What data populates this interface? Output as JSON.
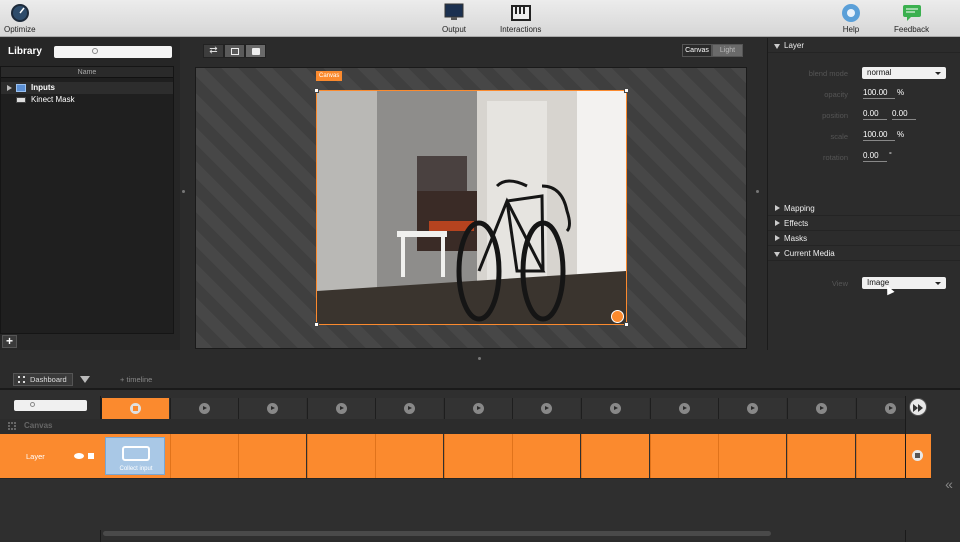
{
  "toolbar": {
    "optimize": "Optimize",
    "output": "Output",
    "interactions": "Interactions",
    "help": "Help",
    "feedback": "Feedback"
  },
  "library": {
    "title": "Library",
    "column_header": "Name",
    "items": [
      {
        "label": "Inputs",
        "icon": "folder-icon"
      },
      {
        "label": "Kinect Mask",
        "icon": "kinect-icon"
      }
    ],
    "add_label": "+"
  },
  "viewer": {
    "canvas_tag": "Canvas",
    "mode_canvas": "Canvas",
    "mode_light": "Light"
  },
  "layer_panel": {
    "title": "Layer",
    "blend_mode_label": "blend mode",
    "blend_mode_value": "normal",
    "opacity_label": "opacity",
    "opacity_value": "100.00",
    "opacity_unit": "%",
    "position_label": "position",
    "position_x": "0.00",
    "position_y": "0.00",
    "scale_label": "scale",
    "scale_value": "100.00",
    "scale_unit": "%",
    "rotation_label": "rotation",
    "rotation_value": "0.00",
    "rotation_unit": "°"
  },
  "sections": {
    "mapping": "Mapping",
    "effects": "Effects",
    "masks": "Masks",
    "current_media": "Current Media"
  },
  "current_media": {
    "view_label": "View",
    "view_value": "Image"
  },
  "dashboard": {
    "tab_label": "Dashboard",
    "timeline_label": "+ timeline",
    "canvas_label": "Canvas",
    "layer_label": "Layer",
    "clip_label": "Collect input"
  },
  "colors": {
    "accent": "#fb8a2e",
    "clip": "#a9c8e6"
  }
}
